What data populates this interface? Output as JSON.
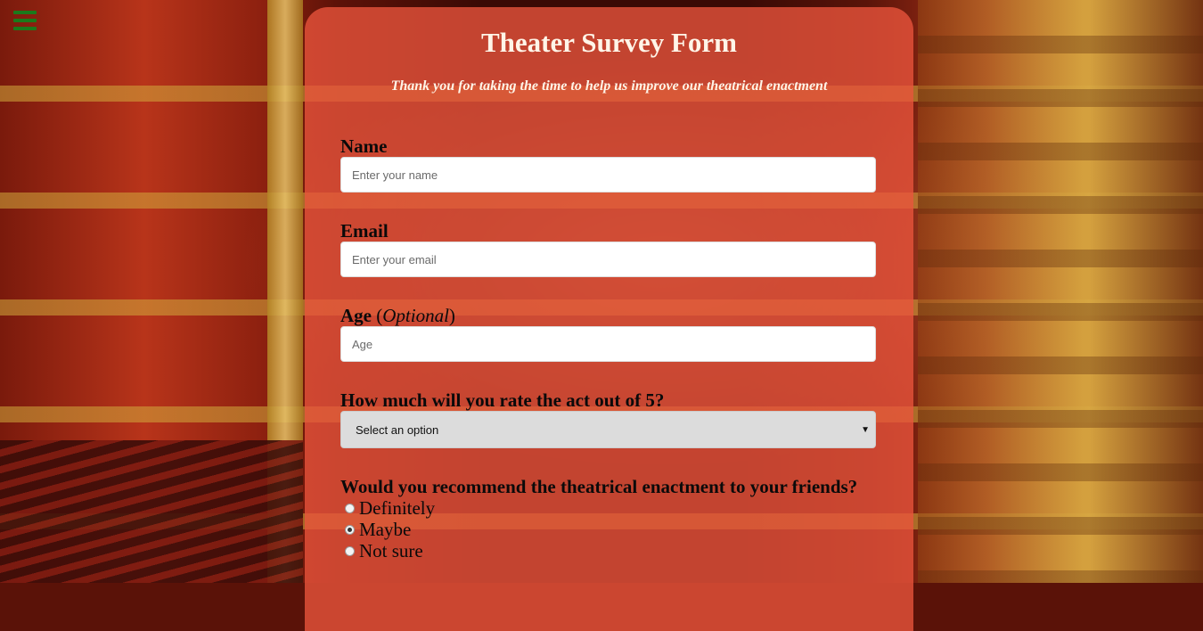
{
  "colors": {
    "panel": "#eb553c",
    "heading_text": "#fff5e8",
    "menu_icon": "#1b7a1b"
  },
  "menu": {
    "icon": "hamburger-menu-icon"
  },
  "form": {
    "title": "Theater Survey Form",
    "subtitle": "Thank you for taking the time to help us improve our theatrical enactment",
    "name": {
      "label": "Name",
      "placeholder": "Enter your name",
      "value": ""
    },
    "email": {
      "label": "Email",
      "placeholder": "Enter your email",
      "value": ""
    },
    "age": {
      "label": "Age",
      "optional": "Optional",
      "placeholder": "Age",
      "value": ""
    },
    "rating": {
      "label": "How much will you rate the act out of 5?",
      "selected": "Select an option",
      "caret_icon": "dropdown-caret-icon"
    },
    "recommend": {
      "label": "Would you recommend the theatrical enactment to your friends?",
      "options": [
        {
          "label": "Definitely",
          "checked": false
        },
        {
          "label": "Maybe",
          "checked": true
        },
        {
          "label": "Not sure",
          "checked": false
        }
      ]
    }
  }
}
